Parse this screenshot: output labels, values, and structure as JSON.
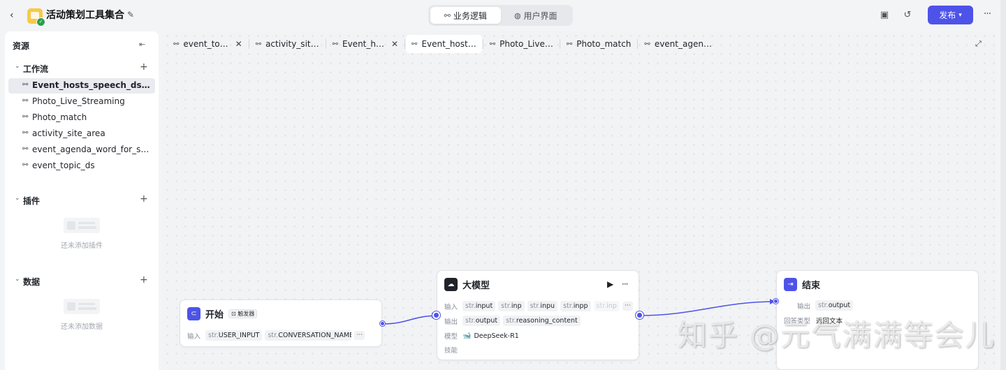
{
  "header": {
    "app_title": "活动策划工具集合",
    "view_tabs": [
      {
        "label": "业务逻辑",
        "active": true
      },
      {
        "label": "用户界面",
        "active": false
      }
    ],
    "publish_label": "发布",
    "accent_color": "#4d53e8"
  },
  "sidebar": {
    "title": "资源",
    "workflow_label": "工作流",
    "workflows": [
      "Event_hosts_speech_ds_upgrade",
      "Photo_Live_Streaming",
      "Photo_match",
      "activity_site_area",
      "event_agenda_word_for_speech",
      "event_topic_ds"
    ],
    "plugins_label": "插件",
    "plugins_empty": "还未添加插件",
    "data_label": "数据",
    "data_empty": "还未添加数据"
  },
  "tabs": [
    {
      "label": "event_to…",
      "closable": true,
      "active": false
    },
    {
      "label": "activity_sit…",
      "closable": false,
      "active": false
    },
    {
      "label": "Event_h…",
      "closable": true,
      "active": false
    },
    {
      "label": "Event_host…",
      "closable": false,
      "active": true
    },
    {
      "label": "Photo_Live…",
      "closable": false,
      "active": false
    },
    {
      "label": "Photo_match",
      "closable": false,
      "active": false
    },
    {
      "label": "event_agen…",
      "closable": false,
      "active": false
    }
  ],
  "nodes": {
    "start": {
      "title": "开始",
      "badge": "触发器",
      "input_label": "输入",
      "inputs": [
        {
          "type": "str.",
          "name": "USER_INPUT"
        },
        {
          "type": "str.",
          "name": "CONVERSATION_NAME"
        }
      ]
    },
    "llm": {
      "title": "大模型",
      "input_label": "输入",
      "inputs": [
        {
          "type": "str.",
          "name": "input"
        },
        {
          "type": "str.",
          "name": "inp"
        },
        {
          "type": "str.",
          "name": "inpu"
        },
        {
          "type": "str.",
          "name": "inpp"
        },
        {
          "type": "str.",
          "name": "inp"
        }
      ],
      "output_label": "输出",
      "outputs": [
        {
          "type": "str.",
          "name": "output"
        },
        {
          "type": "str.",
          "name": "reasoning_content"
        }
      ],
      "model_label": "模型",
      "model": "DeepSeek-R1",
      "skills_label": "技能"
    },
    "end": {
      "title": "结束",
      "output_label": "输出",
      "outputs": [
        {
          "type": "str.",
          "name": "output"
        }
      ],
      "answer_label": "回答类型",
      "answer_value": "返回文本"
    }
  },
  "watermark": "知乎 @元气满满等会儿"
}
